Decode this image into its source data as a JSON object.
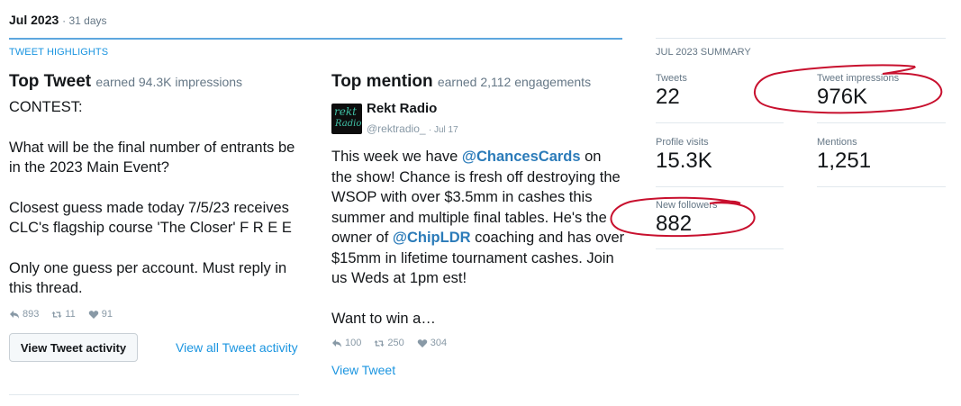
{
  "header": {
    "month": "Jul 2023",
    "days": "· 31 days"
  },
  "highlights": {
    "section_label": "TWEET HIGHLIGHTS"
  },
  "top_tweet": {
    "title": "Top Tweet",
    "subtitle": "earned 94.3K impressions",
    "lines": [
      "CONTEST:",
      "",
      "What will be the final number of entrants be",
      "in the 2023 Main Event?",
      "",
      "Closest guess made today 7/5/23 receives",
      "CLC's flagship course 'The Closer' F R E E",
      "",
      "Only one guess per account. Must reply in",
      "this thread."
    ],
    "retweets": "893",
    "replies": "11",
    "likes": "91",
    "activity_button": "View Tweet activity",
    "all_activity_link": "View all Tweet activity"
  },
  "top_mention": {
    "title": "Top mention",
    "subtitle": "earned 2,112 engagements",
    "avatar_line1": "rekt",
    "avatar_line2": "Radio",
    "account_name": "Rekt Radio",
    "handle": "@rektradio_",
    "date": "· Jul 17",
    "text": {
      "l1a": "This week we have ",
      "l1m": "@ChancesCards",
      "l1b": " on",
      "l2": "the show!  Chance is fresh off destroying the",
      "l3": "WSOP with over $3.5mm in cashes this",
      "l4": "summer and multiple final tables.  He's the",
      "l5a": "owner of ",
      "l5m": "@ChipLDR",
      "l5b": " coaching and has over",
      "l6": "$15mm in lifetime tournament cashes.  Join",
      "l7": "us Weds at 1pm est!",
      "l8": "Want to win a…"
    },
    "retweets": "100",
    "replies": "250",
    "likes": "304",
    "view_link": "View Tweet"
  },
  "summary": {
    "section_label": "JUL 2023 SUMMARY",
    "tweets_label": "Tweets",
    "tweets_value": "22",
    "impressions_label": "Tweet impressions",
    "impressions_value": "976K",
    "profile_visits_label": "Profile visits",
    "profile_visits_value": "15.3K",
    "mentions_label": "Mentions",
    "mentions_value": "1,251",
    "new_followers_label": "New followers",
    "new_followers_value": "882"
  },
  "colors": {
    "accent_blue": "#1b95e0",
    "mention_blue": "#2b7bb9",
    "annotation_red": "#c8102e"
  },
  "icons": [
    "reply-icon",
    "retweet-icon",
    "like-icon"
  ]
}
